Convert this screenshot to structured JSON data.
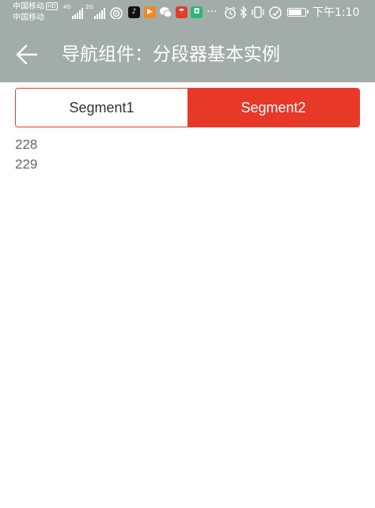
{
  "status_bar": {
    "carrier_1": "中国移动",
    "hd_badge": "HD",
    "carrier_2": "中国移动",
    "signal_1_label": "4G",
    "signal_2_label": "2G",
    "more_indicator": "···",
    "battery_level": 0.85,
    "time": "下午1:10",
    "app_icons": [
      {
        "name": "tiktok-icon",
        "color": "#111111"
      },
      {
        "name": "video-play-icon",
        "color": "#f08a24"
      },
      {
        "name": "wechat-icon",
        "color": "#ffffff"
      },
      {
        "name": "umbrella-app-icon",
        "color": "#e23b2e"
      },
      {
        "name": "green-app-icon",
        "color": "#2bb673"
      }
    ]
  },
  "nav": {
    "back_icon": "arrow-left-icon",
    "title": "导航组件：分段器基本实例"
  },
  "segments": {
    "items": [
      {
        "label": "Segment1",
        "selected": false
      },
      {
        "label": "Segment2",
        "selected": true
      }
    ],
    "accent_color": "#e83828"
  },
  "list": {
    "items": [
      "228",
      "229"
    ]
  }
}
